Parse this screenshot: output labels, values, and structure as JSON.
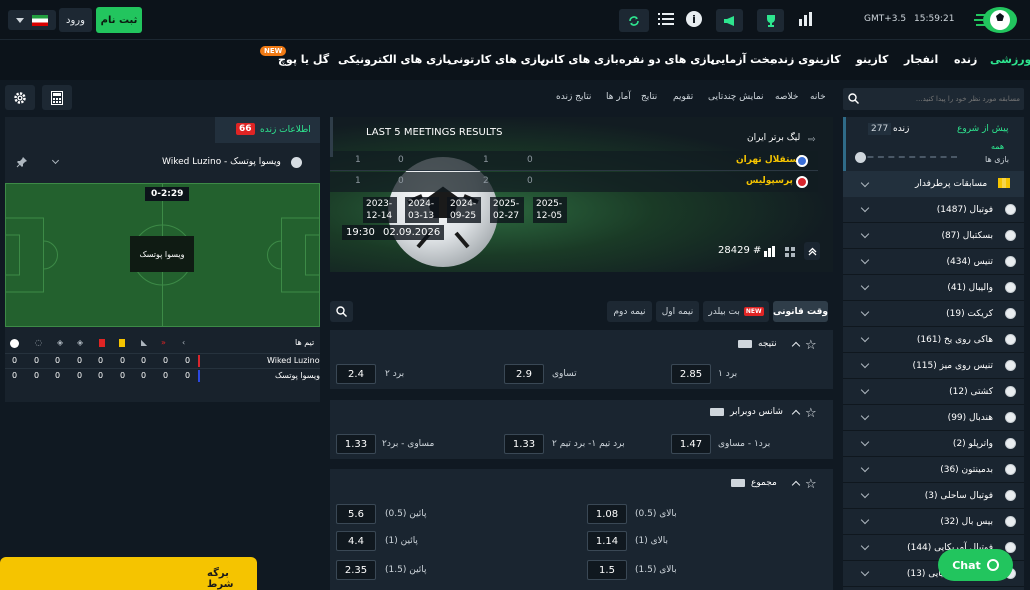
{
  "header": {
    "clock": "15:59:21",
    "timezone": "GMT+3.5",
    "register_label": "ثبت نام",
    "login_label": "ورود",
    "new_badge": "NEW"
  },
  "nav": {
    "items": [
      "ورزشی",
      "زنده",
      "انفجار",
      "کازینو",
      "کازینوی زنده",
      "بخت آزمایی",
      "بازی های دو نفره",
      "بازی های کانن",
      "بازی های کارتونی",
      "بازی های الکترونیکی",
      "گل یا پوچ"
    ]
  },
  "sidebar": {
    "search_placeholder": "مسابقه مورد نظر خود را پیدا کنید...",
    "tab_upcoming": "پیش از شروع",
    "tab_live": "زنده",
    "live_count": "277",
    "all_label": "همه",
    "games_label": "بازی ها",
    "popular_label": "مسابقات پرطرفدار",
    "sports": [
      {
        "name": "فوتبال (1487)",
        "icon": "soccer-icon"
      },
      {
        "name": "بسکتبال (87)",
        "icon": "basketball-icon"
      },
      {
        "name": "تنیس (434)",
        "icon": "tennis-icon"
      },
      {
        "name": "والیبال (41)",
        "icon": "volleyball-icon"
      },
      {
        "name": "کریکت (19)",
        "icon": "cricket-icon"
      },
      {
        "name": "هاکی روی یخ (161)",
        "icon": "hockey-icon"
      },
      {
        "name": "تنیس روی میز (115)",
        "icon": "table-tennis-icon"
      },
      {
        "name": "کشتی (12)",
        "icon": "wrestling-icon"
      },
      {
        "name": "هندبال (99)",
        "icon": "handball-icon"
      },
      {
        "name": "واترپلو (2)",
        "icon": "waterpolo-icon"
      },
      {
        "name": "بدمینتون (36)",
        "icon": "badminton-icon"
      },
      {
        "name": "فوتبال ساحلی (3)",
        "icon": "beach-soccer-icon"
      },
      {
        "name": "بیس بال (32)",
        "icon": "baseball-icon"
      },
      {
        "name": "فوتبال آمریکایی (144)",
        "icon": "american-football-icon"
      },
      {
        "name": "فوتبال استرالیایی (13)",
        "icon": "aussie-rules-icon"
      }
    ]
  },
  "breadcrumb": [
    "خانه",
    "خلاصه",
    "نمایش چندتایی",
    "تقویم",
    "نتایج",
    "آمار ها",
    "نتایج زنده"
  ],
  "match": {
    "meetings_title": "LAST 5 MEETINGS RESULTS",
    "league": "لیگ برتر ایران",
    "team1": "استقلال تهران",
    "team2": "پرسپولیس",
    "team1_scores": [
      "1",
      "0",
      "1",
      "0"
    ],
    "team2_scores": [
      "1",
      "0",
      "2",
      "0"
    ],
    "dates": [
      "2025-12-05",
      "2025-02-27",
      "2024-09-25",
      "2024-03-13",
      "2023-12-14"
    ],
    "match_date": "02.09.2026",
    "match_time": "19:30",
    "market_count": "28429 #"
  },
  "filters": {
    "regular_time": "وقت قانونی",
    "bet_builder": "بت بیلدر",
    "first_half": "نیمه اول",
    "second_half": "نیمه دوم",
    "new_badge": "NEW"
  },
  "markets": {
    "result": {
      "title": "نتیجه",
      "odds": [
        {
          "label": "برد ۱",
          "value": "2.85"
        },
        {
          "label": "تساوی",
          "value": "2.9"
        },
        {
          "label": "برد ۲",
          "value": "2.4"
        }
      ]
    },
    "double_chance": {
      "title": "شانس دوبرابر",
      "odds": [
        {
          "label": "برد۱ - مساوی",
          "value": "1.47"
        },
        {
          "label": "برد تیم ۱- برد تیم ۲",
          "value": "1.33"
        },
        {
          "label": "مساوی - برد۲",
          "value": "1.33"
        }
      ]
    },
    "total": {
      "title": "مجموع",
      "rows": [
        {
          "over_label": "بالای (0.5)",
          "over": "1.08",
          "under_label": "پائین (0.5)",
          "under": "5.6"
        },
        {
          "over_label": "بالای (1)",
          "over": "1.14",
          "under_label": "پائین (1)",
          "under": "4.4"
        },
        {
          "over_label": "بالای (1.5)",
          "over": "1.5",
          "under_label": "پائین (1.5)",
          "under": "2.35"
        }
      ]
    }
  },
  "live_info": {
    "title": "اطلاعات زنده",
    "count": "66",
    "match_name": "Wiked Luzino - ویسوا پوتسک",
    "score_time": "0-2:29",
    "field_label": "ویسوا پوتسک",
    "teams_header": "تیم ها",
    "teams": [
      {
        "name": "Wiked Luzino",
        "stats": [
          "0",
          "0",
          "0",
          "0",
          "0",
          "0",
          "0",
          "0",
          "0"
        ],
        "color": "#d8262d"
      },
      {
        "name": "ویسوا پوتسک",
        "stats": [
          "0",
          "0",
          "0",
          "0",
          "0",
          "0",
          "0",
          "0",
          "0"
        ],
        "color": "#2b48e0"
      }
    ]
  },
  "betslip": {
    "title": "برگه شرط"
  },
  "chat": {
    "label": "Chat"
  },
  "colors": {
    "accent": "#2ee58f",
    "brand_green": "#22c55e",
    "background": "#101922",
    "panel": "#1a2530",
    "betslip": "#f5c400",
    "live_badge": "#e02424"
  }
}
